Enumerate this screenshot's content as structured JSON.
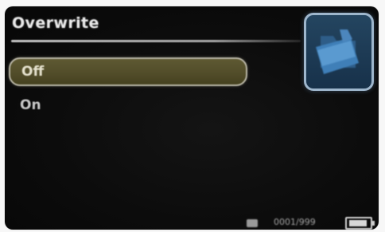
{
  "menu": {
    "title": "Overwrite",
    "options": [
      {
        "label": "Off",
        "selected": true
      },
      {
        "label": "On",
        "selected": false
      }
    ]
  },
  "status_bar": {
    "counter_text": "0001/999",
    "icons": [
      "media-icon",
      "battery-icon"
    ]
  },
  "header_icon": "overwrite-folder-icon",
  "colors": {
    "background": "#0d0d0d",
    "selection_fill": "#57522c",
    "selection_border": "#b9b6a6",
    "icon_frame": "#9eb6cc",
    "icon_bg": "#1e3a55",
    "text": "#e0e0e0"
  }
}
